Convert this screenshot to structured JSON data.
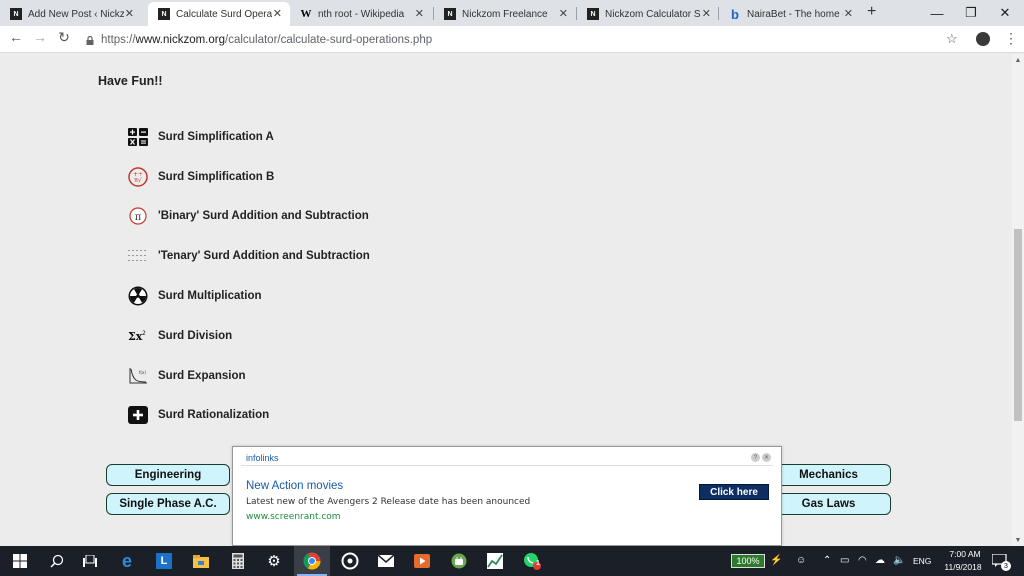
{
  "tabs": [
    {
      "title": "Add New Post ‹ Nickzom",
      "icon": "nickzom-icon"
    },
    {
      "title": "Calculate Surd Operations",
      "icon": "nickzom-icon"
    },
    {
      "title": "nth root - Wikipedia",
      "icon": "wikipedia-icon"
    },
    {
      "title": "Nickzom Freelance",
      "icon": "nickzom-icon"
    },
    {
      "title": "Nickzom Calculator Sol",
      "icon": "nickzom-icon"
    },
    {
      "title": "NairaBet - The home of",
      "icon": "nairabet-icon"
    }
  ],
  "address_bar": {
    "scheme": "https://",
    "host": "www.nickzom.org",
    "path": "/calculator/calculate-surd-operations.php"
  },
  "page": {
    "heading": "Have Fun!!",
    "links": [
      {
        "label": "Surd Simplification A",
        "icon": "calculator-keys-icon"
      },
      {
        "label": "Surd Simplification B",
        "icon": "math-symbols-icon"
      },
      {
        "label": "'Binary' Surd Addition and Subtraction",
        "icon": "pi-icon"
      },
      {
        "label": "'Tenary' Surd Addition and Subtraction",
        "icon": "dot-grid-icon"
      },
      {
        "label": "Surd Multiplication",
        "icon": "radiation-icon"
      },
      {
        "label": "Surd Division",
        "icon": "sigma-icon"
      },
      {
        "label": "Surd Expansion",
        "icon": "curve-graph-icon"
      },
      {
        "label": "Surd Rationalization",
        "icon": "plus-square-icon"
      }
    ],
    "buttons": {
      "engineering": "Engineering",
      "single_phase": "Single Phase A.C.",
      "mechanics": "Mechanics",
      "gas_laws": "Gas Laws"
    }
  },
  "ad": {
    "brand": "infolinks",
    "title": "New Action movies",
    "description": "Latest new of the Avengers 2 Release date has been anounced",
    "url": "www.screenrant.com",
    "cta": "Click here"
  },
  "taskbar": {
    "battery": "100%",
    "language": "ENG",
    "time": "7:00 AM",
    "date": "11/9/2018",
    "whatsapp_badge": "1",
    "notification_count": "3"
  },
  "colors": {
    "button_fill": "#cff4fb",
    "button_border": "#1b3d2f",
    "ad_cta": "#0d2e63",
    "taskbar": "#1b1f27"
  }
}
